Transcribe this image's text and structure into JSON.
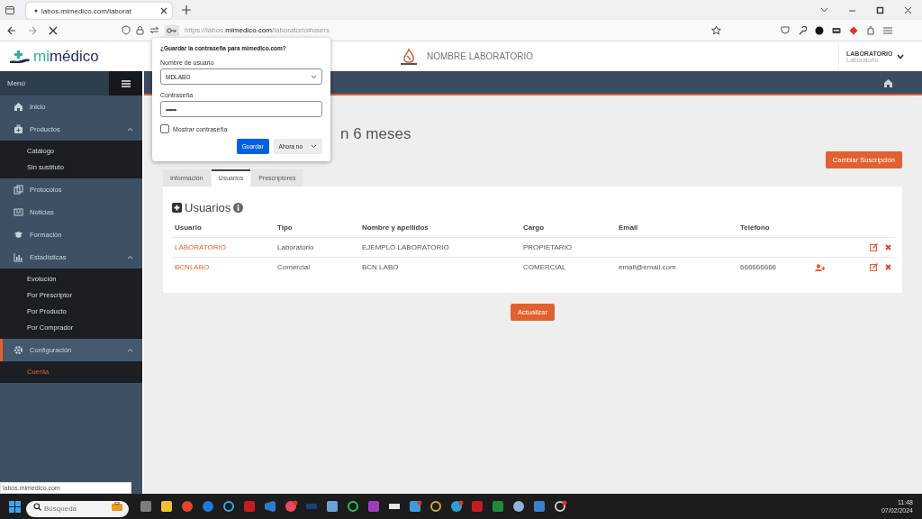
{
  "browser": {
    "tab_title": "labos.mimedico.com/laborat",
    "url": {
      "prefix": "https://labos.",
      "domain": "mimedico.com",
      "path": "/laboratorio#users"
    },
    "status_text": "labos.mimedico.com"
  },
  "password_popup": {
    "title": "¿Guardar la contraseña para mimedico.com?",
    "username_label": "Nombre de usuario",
    "username": "MDLABO",
    "password_label": "Contraseña",
    "password": "••••••",
    "show_password": {
      "label": "Mostrar contraseña",
      "checked": false
    },
    "save_button": "Guardar",
    "dismiss_button": "Ahora no"
  },
  "header": {
    "logo": [
      "mi",
      "médico"
    ],
    "lab_name": "NOMBRE LABORATORIO",
    "user": {
      "name": "LABORATORIO",
      "role": "Laboratorio"
    }
  },
  "sidebar": {
    "title": "Menú",
    "items": [
      {
        "label": "Inicio",
        "selected": false
      },
      {
        "label": "Productos",
        "selected": false,
        "expanded": true,
        "children": [
          {
            "label": "Catálogo",
            "selected": false
          },
          {
            "label": "Sin sustituto",
            "selected": false
          }
        ]
      },
      {
        "label": "Protocolos",
        "selected": false
      },
      {
        "label": "Noticias",
        "selected": false
      },
      {
        "label": "Formación",
        "selected": false
      },
      {
        "label": "Estadísticas",
        "selected": false,
        "expanded": true,
        "children": [
          {
            "label": "Evolución",
            "selected": false
          },
          {
            "label": "Por Prescriptor",
            "selected": false
          },
          {
            "label": "Por Producto",
            "selected": false
          },
          {
            "label": "Por Comprador",
            "selected": false
          }
        ]
      },
      {
        "label": "Configuración",
        "selected": true,
        "expanded": true,
        "children": [
          {
            "label": "Cuenta",
            "selected": true
          }
        ]
      }
    ]
  },
  "page": {
    "heading": "n 6 meses",
    "subscription_button": "Cambiar Suscripción",
    "tabs": [
      {
        "label": "Información",
        "selected": false
      },
      {
        "label": "Usuarios",
        "selected": true
      },
      {
        "label": "Prescriptores",
        "selected": false
      }
    ],
    "panel_title": "Usuarios",
    "table": {
      "columns": [
        "Usuario",
        "Tipo",
        "Nombre y apellidos",
        "Cargo",
        "Email",
        "Teléfono"
      ],
      "rows": [
        {
          "cells": [
            "LABORATORIO",
            "Laboratorio",
            "EJEMPLO LABORATORIO",
            "PROPIETARIO",
            "",
            ""
          ],
          "assign_icon": false
        },
        {
          "cells": [
            "BCNLABO",
            "Comercial",
            "BCN LABO",
            "COMERCIAL",
            "email@email.com",
            "666666666"
          ],
          "assign_icon": true
        }
      ]
    },
    "update_button": "Actualizar"
  },
  "taskbar": {
    "search_placeholder": "Búsqueda",
    "time": "11:48",
    "date": "07/02/2024"
  }
}
